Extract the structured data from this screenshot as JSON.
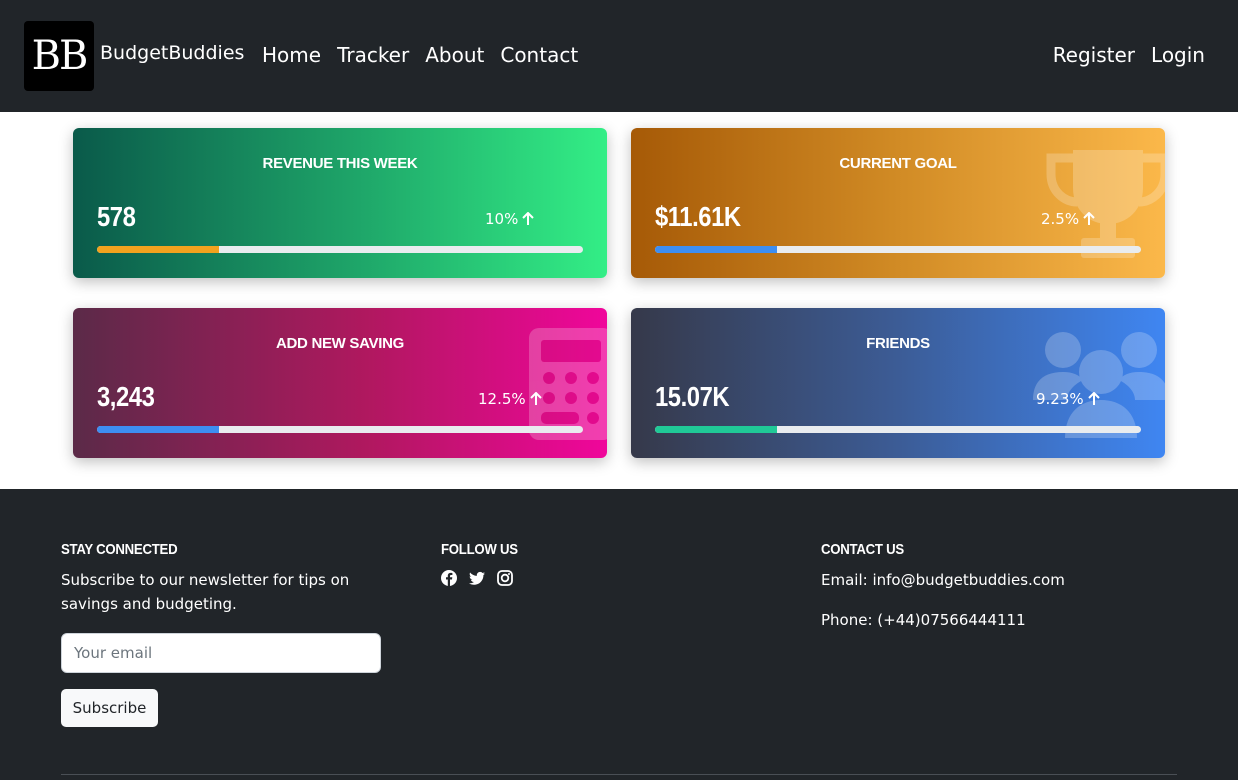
{
  "nav": {
    "logo_text": "BB",
    "brand": "BudgetBuddies",
    "links": [
      "Home",
      "Tracker",
      "About",
      "Contact"
    ],
    "right_links": [
      "Register",
      "Login"
    ]
  },
  "cards": [
    {
      "title": "Revenue this week",
      "value": "578",
      "pct": "10%",
      "progress": 0.25,
      "bar_color": "#f2a21e",
      "icon": "dollar-icon"
    },
    {
      "title": "Current Goal",
      "value": "$11.61K",
      "pct": "2.5%",
      "progress": 0.25,
      "bar_color": "#3d8ef2",
      "icon": "trophy-icon"
    },
    {
      "title": "Add new saving",
      "value": "3,243",
      "pct": "12.5%",
      "progress": 0.25,
      "bar_color": "#3d8ef2",
      "icon": "calculator-icon"
    },
    {
      "title": "Friends",
      "value": "15.07K",
      "pct": "9.23%",
      "progress": 0.25,
      "bar_color": "#20c997",
      "icon": "users-icon"
    }
  ],
  "footer": {
    "stay": {
      "heading": "Stay Connected",
      "text": "Subscribe to our newsletter for tips on savings and budgeting.",
      "email_placeholder": "Your email",
      "button": "Subscribe"
    },
    "follow": {
      "heading": "Follow Us",
      "icons": [
        "facebook-icon",
        "twitter-icon",
        "instagram-icon"
      ]
    },
    "contact": {
      "heading": "Contact Us",
      "email": "Email: info@budgetbuddies.com",
      "phone": "Phone: (+44)07566444111"
    }
  }
}
